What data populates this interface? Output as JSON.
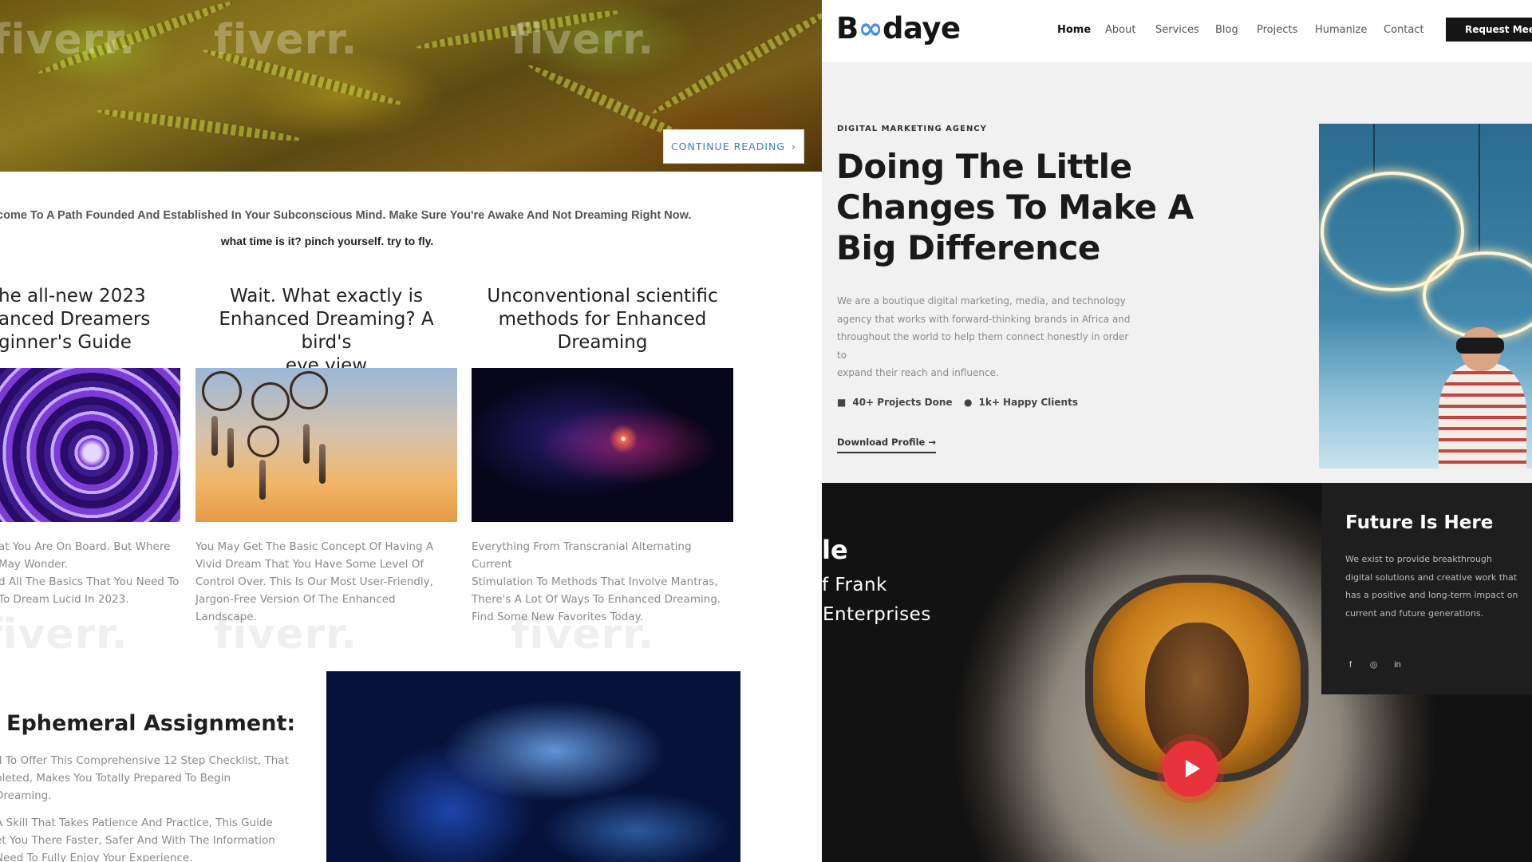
{
  "left_blog": {
    "watermark": "fiverr.",
    "continue_label": "CONTINUE READING",
    "welcome": "lcome To A Path Founded And Established In Your Subconscious Mind. Make Sure You're Awake And Not Dreaming Right Now.",
    "tagline": "what time is it? pinch yourself. try to fly.",
    "posts": [
      {
        "title": "he all-new 2023\nanced Dreamers\nginner's Guide",
        "excerpt": "at You Are On Board. But Where\nMay Wonder.\nd All The Basics That You Need To\nTo Dream Lucid In 2023."
      },
      {
        "title": "Wait. What exactly is\nEnhanced Dreaming? A bird's\neye view",
        "excerpt": "You May Get The Basic Concept Of Having A\nVivid Dream That You Have Some Level Of\nControl Over. This Is Our Most User-Friendly,\nJargon-Free Version Of The Enhanced\nLandscape."
      },
      {
        "title": "Unconventional scientific\nmethods for Enhanced\nDreaming",
        "excerpt": "Everything From Transcranial Alternating Current\nStimulation To Methods That Involve Mantras,\nThere's A Lot Of Ways To Enhanced Dreaming.\nFind Some New Favorites Today."
      }
    ],
    "assignment": {
      "title": "Ephemeral Assignment:",
      "para1": "d To Offer This Comprehensive 12 Step Checklist, That\npleted, Makes You Totally Prepared To Begin\nDreaming.",
      "para2": "A Skill That Takes Patience And Practice, This Guide\net You There Faster, Safer And With The Information\nNeed To Fully Enjoy Your Experience."
    }
  },
  "right_agency": {
    "logo": {
      "pre": "B",
      "mark": "∞",
      "post": "daye"
    },
    "nav": [
      "Home",
      "About",
      "Services",
      "Blog",
      "Projects",
      "Humanize",
      "Contact"
    ],
    "active_nav": "Home",
    "cta_label": "Request Meeting",
    "eyebrow": "DIGITAL MARKETING AGENCY",
    "headline": "Doing The Little\nChanges To Make A\nBig Difference",
    "intro": "We are a boutique digital marketing, media, and technology\nagency that works with forward-thinking brands in Africa and\nthroughout the world to help them connect honestly in order to\nexpand their reach and influence.",
    "stats": [
      {
        "icon": "briefcase-icon",
        "label": "40+ Projects Done"
      },
      {
        "icon": "user-icon",
        "label": "1k+ Happy Clients"
      }
    ],
    "download_label": "Download Profile →",
    "video": {
      "partial_title": "le",
      "partial_line1": "f Frank",
      "partial_line2": "Enterprises"
    },
    "future": {
      "title": "Future Is Here",
      "text": "We exist to provide breakthrough digital solutions and creative work that has a positive and long-term impact on current and future generations.",
      "socials": [
        "facebook-icon",
        "instagram-icon",
        "linkedin-icon"
      ]
    },
    "colors": {
      "accent_blue": "#4a8fe0",
      "play_red": "#e8333c",
      "dark": "#151515"
    }
  }
}
